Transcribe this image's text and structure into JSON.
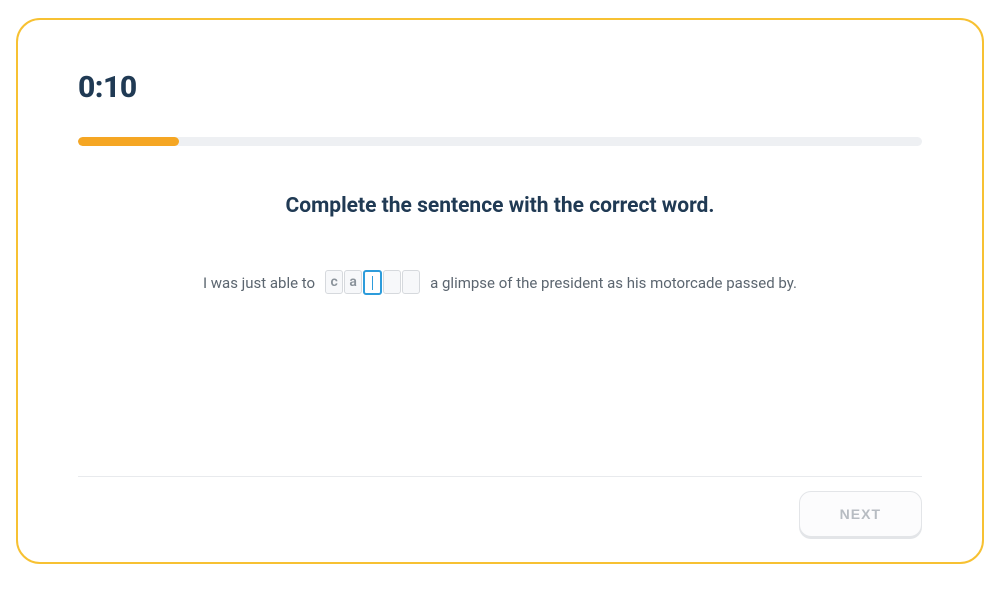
{
  "timer": "0:10",
  "progress_percent": 12,
  "instruction": "Complete the sentence with the correct word.",
  "sentence": {
    "before": "I was just able to",
    "after": "a glimpse of the president as his motorcade passed by."
  },
  "letters": {
    "filled": [
      "c",
      "a"
    ],
    "total_boxes": 5,
    "active_index": 2
  },
  "next_label": "NEXT"
}
